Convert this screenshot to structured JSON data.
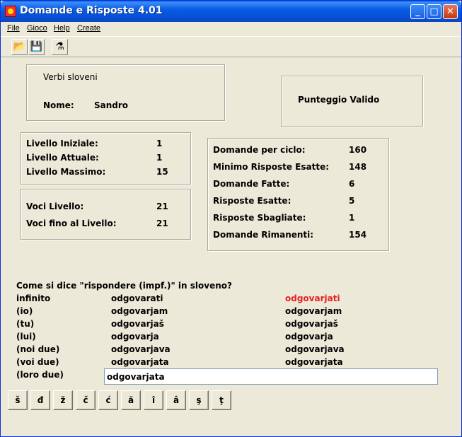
{
  "window": {
    "title": "Domande e Risposte 4.01",
    "min": "_",
    "max": "□",
    "close": "✕"
  },
  "menu": [
    "File",
    "Gioco",
    "Help",
    "Create"
  ],
  "toolbar": {
    "open_icon": "📂",
    "save_icon": "💾",
    "tool_icon": "⚗"
  },
  "header": {
    "subject": "Verbi sloveni",
    "name_label": "Nome:",
    "name_value": "Sandro",
    "score_status": "Punteggio Valido"
  },
  "levels": [
    {
      "label": "Livello Iniziale:",
      "value": "1"
    },
    {
      "label": "Livello Attuale:",
      "value": "1"
    },
    {
      "label": "Livello Massimo:",
      "value": "15"
    }
  ],
  "voci": [
    {
      "label": "Voci Livello:",
      "value": "21"
    },
    {
      "label": "Voci fino al Livello:",
      "value": "21"
    }
  ],
  "stats": [
    {
      "label": "Domande per ciclo:",
      "value": "160"
    },
    {
      "label": "Minimo Risposte Esatte:",
      "value": "148"
    },
    {
      "label": "Domande Fatte:",
      "value": "6"
    },
    {
      "label": "Risposte Esatte:",
      "value": "5"
    },
    {
      "label": "Risposte Sbagliate:",
      "value": "1"
    },
    {
      "label": "Domande Rimanenti:",
      "value": "154"
    }
  ],
  "question": "Come si dice \"rispondere (impf.)\" in sloveno?",
  "rows": [
    {
      "person": "infinito",
      "answer": "odgovarati",
      "correct": "odgovarjati"
    },
    {
      "person": "(io)",
      "answer": "odgovarjam",
      "correct": "odgovarjam"
    },
    {
      "person": "(tu)",
      "answer": "odgovarjaš",
      "correct": "odgovarjaš"
    },
    {
      "person": "(lui)",
      "answer": "odgovarja",
      "correct": "odgovarja"
    },
    {
      "person": "(noi due)",
      "answer": "odgovarjava",
      "correct": "odgovarjava"
    },
    {
      "person": "(voi due)",
      "answer": "odgovarjata",
      "correct": "odgovarjata"
    }
  ],
  "current": {
    "person": "(loro due)",
    "input_value": "odgovarjata"
  },
  "chars": [
    "š",
    "đ",
    "ž",
    "č",
    "ć",
    "ă",
    "î",
    "â",
    "ş",
    "ţ"
  ],
  "colors": {
    "wrong_correction": "#E82020",
    "titlebar": "#0A5FE8",
    "background": "#ECE9D8"
  }
}
